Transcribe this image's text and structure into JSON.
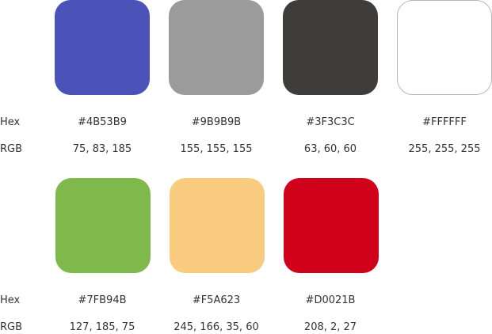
{
  "row_labels": {
    "hex": "Hex",
    "rgb": "RGB"
  },
  "swatches": [
    {
      "name": "blue",
      "hex": "#4B53B9",
      "rgb": "75, 83, 185",
      "fill": "#4B53B9"
    },
    {
      "name": "gray",
      "hex": "#9B9B9B",
      "rgb": "155, 155, 155",
      "fill": "#9B9B9B"
    },
    {
      "name": "dark-gray",
      "hex": "#3F3C3C",
      "rgb": "63, 60, 60",
      "fill": "#3F3C3C"
    },
    {
      "name": "white",
      "hex": "#FFFFFF",
      "rgb": "255, 255, 255",
      "fill": "#FFFFFF"
    },
    {
      "name": "green",
      "hex": "#7FB94B",
      "rgb": "127, 185, 75",
      "fill": "#7FB94B"
    },
    {
      "name": "orange",
      "hex": "#F5A623",
      "rgb": "245, 166, 35, 60",
      "fill": "#F8CB7F"
    },
    {
      "name": "red",
      "hex": "#D0021B",
      "rgb": "208, 2, 27",
      "fill": "#D0021B"
    }
  ]
}
